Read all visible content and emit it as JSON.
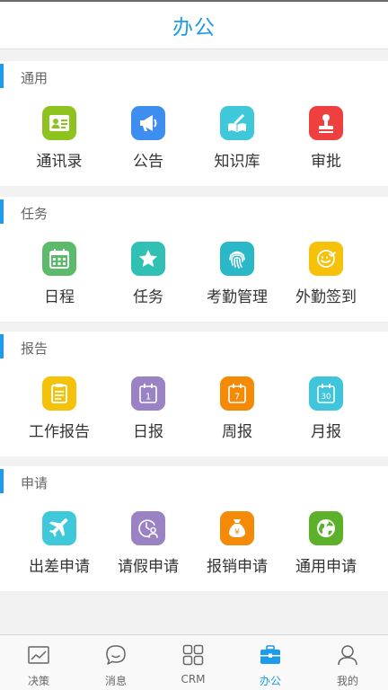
{
  "header": {
    "title": "办公"
  },
  "sections": [
    {
      "title": "通用",
      "items": [
        {
          "label": "通讯录",
          "icon": "contacts-icon",
          "color": "#8dc21f"
        },
        {
          "label": "公告",
          "icon": "megaphone-icon",
          "color": "#3e8ef0"
        },
        {
          "label": "知识库",
          "icon": "book-pen-icon",
          "color": "#3fc8da"
        },
        {
          "label": "审批",
          "icon": "stamp-icon",
          "color": "#ef3f3f"
        }
      ]
    },
    {
      "title": "任务",
      "items": [
        {
          "label": "日程",
          "icon": "calendar-grid-icon",
          "color": "#5cbb6a"
        },
        {
          "label": "任务",
          "icon": "star-icon",
          "color": "#30c0b4"
        },
        {
          "label": "考勤管理",
          "icon": "fingerprint-icon",
          "color": "#2ab8c9"
        },
        {
          "label": "外勤签到",
          "icon": "check-badge-icon",
          "color": "#f6c109"
        }
      ]
    },
    {
      "title": "报告",
      "items": [
        {
          "label": "工作报告",
          "icon": "clipboard-icon",
          "color": "#f6c109"
        },
        {
          "label": "日报",
          "icon": "calendar-1-icon",
          "color": "#9a82c4",
          "badge": "1"
        },
        {
          "label": "周报",
          "icon": "calendar-7-icon",
          "color": "#f58a07",
          "badge": "7"
        },
        {
          "label": "月报",
          "icon": "calendar-30-icon",
          "color": "#40c5dd",
          "badge": "30"
        }
      ]
    },
    {
      "title": "申请",
      "items": [
        {
          "label": "出差申请",
          "icon": "airplane-icon",
          "color": "#3fc8da"
        },
        {
          "label": "请假申请",
          "icon": "leave-clock-icon",
          "color": "#9a82c4"
        },
        {
          "label": "报销申请",
          "icon": "money-bag-icon",
          "color": "#f58a07",
          "badge": "¥"
        },
        {
          "label": "通用申请",
          "icon": "globe-icon",
          "color": "#5cb02a"
        }
      ]
    }
  ],
  "tabbar": {
    "items": [
      {
        "label": "决策",
        "icon": "chart-icon",
        "active": false
      },
      {
        "label": "消息",
        "icon": "chat-bubble-icon",
        "active": false
      },
      {
        "label": "CRM",
        "icon": "grid-icon",
        "active": false
      },
      {
        "label": "办公",
        "icon": "briefcase-icon",
        "active": true
      },
      {
        "label": "我的",
        "icon": "person-icon",
        "active": false
      }
    ],
    "active_color": "#1e9bea",
    "inactive_color": "#666666"
  }
}
